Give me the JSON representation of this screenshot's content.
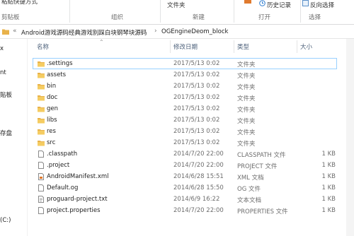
{
  "ribbon": {
    "clipboard_item": "粘贴快捷方式",
    "clipboard_label": "剪贴板",
    "organize_label": "组织",
    "folder_label": "文件夹",
    "new_label": "新建",
    "history_label": "历史记录",
    "open_label": "打开",
    "invert_label": "反向选择",
    "select_label": "选择"
  },
  "address": {
    "overflow": "«",
    "crumbs": [
      "Android游戏源码经典游戏别踩白块钢琴块源码",
      "OGEngineDeom_block"
    ]
  },
  "nav": {
    "items": [
      "x",
      "nt",
      "贴板",
      "存盘",
      "(C:)"
    ]
  },
  "columns": {
    "name": "名称",
    "date": "修改日期",
    "type": "类型",
    "size": "大小"
  },
  "files": [
    {
      "name": ".settings",
      "date": "2017/5/13 0:02",
      "type": "文件夹",
      "size": "",
      "icon": "folder-icon"
    },
    {
      "name": "assets",
      "date": "2017/5/13 0:02",
      "type": "文件夹",
      "size": "",
      "icon": "folder-icon"
    },
    {
      "name": "bin",
      "date": "2017/5/13 0:02",
      "type": "文件夹",
      "size": "",
      "icon": "folder-icon"
    },
    {
      "name": "doc",
      "date": "2017/5/13 0:02",
      "type": "文件夹",
      "size": "",
      "icon": "folder-icon"
    },
    {
      "name": "gen",
      "date": "2017/5/13 0:02",
      "type": "文件夹",
      "size": "",
      "icon": "folder-icon"
    },
    {
      "name": "libs",
      "date": "2017/5/13 0:02",
      "type": "文件夹",
      "size": "",
      "icon": "folder-icon"
    },
    {
      "name": "res",
      "date": "2017/5/13 0:02",
      "type": "文件夹",
      "size": "",
      "icon": "folder-icon"
    },
    {
      "name": "src",
      "date": "2017/5/13 0:02",
      "type": "文件夹",
      "size": "",
      "icon": "folder-icon"
    },
    {
      "name": ".classpath",
      "date": "2014/7/20 22:00",
      "type": "CLASSPATH 文件",
      "size": "1 KB",
      "icon": "file-icon"
    },
    {
      "name": ".project",
      "date": "2014/7/20 22:00",
      "type": "PROJECT 文件",
      "size": "1 KB",
      "icon": "file-icon"
    },
    {
      "name": "AndroidManifest.xml",
      "date": "2014/6/28 15:51",
      "type": "XML 文档",
      "size": "1 KB",
      "icon": "xml-file-icon"
    },
    {
      "name": "Default.og",
      "date": "2014/6/28 15:50",
      "type": "OG 文件",
      "size": "1 KB",
      "icon": "file-icon"
    },
    {
      "name": "proguard-project.txt",
      "date": "2014/6/9 16:22",
      "type": "文本文档",
      "size": "1 KB",
      "icon": "text-file-icon"
    },
    {
      "name": "project.properties",
      "date": "2014/7/20 22:00",
      "type": "PROPERTIES 文件",
      "size": "1 KB",
      "icon": "file-icon"
    }
  ]
}
